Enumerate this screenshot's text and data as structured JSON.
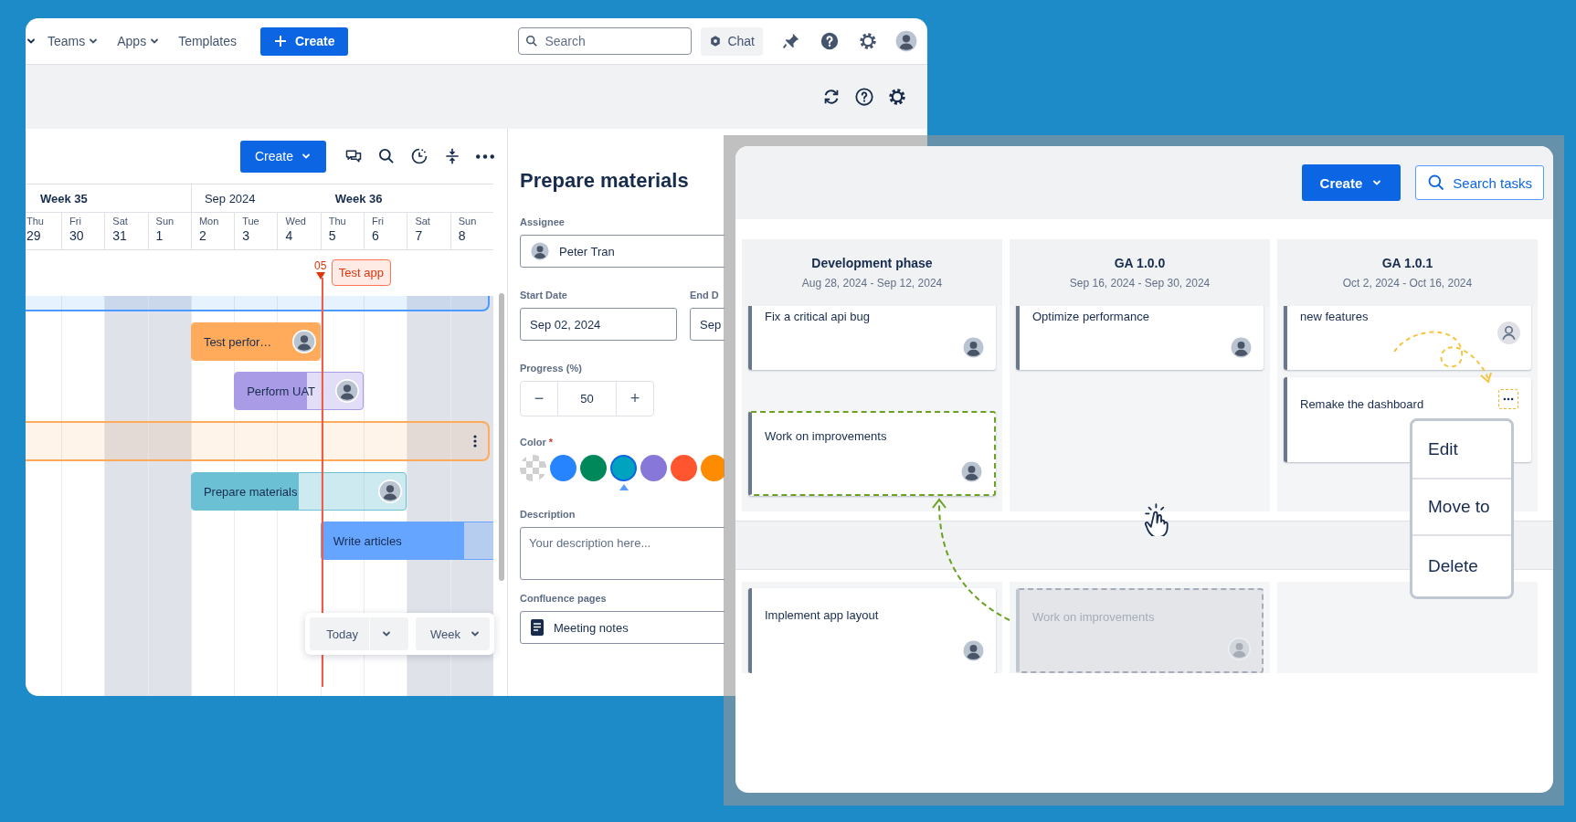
{
  "topbar": {
    "nav": [
      {
        "label": "Teams",
        "dropdown": true
      },
      {
        "label": "Apps",
        "dropdown": true
      },
      {
        "label": "Templates",
        "dropdown": false
      }
    ],
    "create_button": "Create",
    "search": {
      "placeholder": "Search"
    },
    "chat_button": "Chat"
  },
  "gantt": {
    "create_button": "Create",
    "weeks": [
      {
        "label": "Week 35",
        "kind": "week"
      },
      {
        "label": "Sep 2024",
        "kind": "month"
      },
      {
        "label": "Week 36",
        "kind": "week"
      }
    ],
    "days": [
      {
        "weekday": "Thu",
        "date": "29",
        "weekend": false
      },
      {
        "weekday": "Fri",
        "date": "30",
        "weekend": false
      },
      {
        "weekday": "Sat",
        "date": "31",
        "weekend": true
      },
      {
        "weekday": "Sun",
        "date": "1",
        "weekend": true
      },
      {
        "weekday": "Mon",
        "date": "2",
        "weekend": false
      },
      {
        "weekday": "Tue",
        "date": "3",
        "weekend": false
      },
      {
        "weekday": "Wed",
        "date": "4",
        "weekend": false
      },
      {
        "weekday": "Thu",
        "date": "5",
        "weekend": false
      },
      {
        "weekday": "Fri",
        "date": "6",
        "weekend": false
      },
      {
        "weekday": "Sat",
        "date": "7",
        "weekend": true
      },
      {
        "weekday": "Sun",
        "date": "8",
        "weekend": true
      }
    ],
    "milestone": {
      "day_label": "05",
      "title": "Test app"
    },
    "bars": [
      {
        "kind": "group",
        "color": "#4c9aff"
      },
      {
        "kind": "task",
        "title": "Test perfor…",
        "color": "#ffab5b",
        "level": 1,
        "avatar": true
      },
      {
        "kind": "task",
        "title": "Perform UAT",
        "color": "#a99be6",
        "level": 0.56,
        "avatar": true
      },
      {
        "kind": "group",
        "color": "#ffab5b"
      },
      {
        "kind": "task",
        "title": "Prepare materials",
        "color": "#6cc0d4",
        "level": 0.5,
        "avatar": true
      },
      {
        "kind": "task",
        "title": "Write articles",
        "color": "#65a4ff",
        "level": 0.83,
        "avatar": false
      }
    ],
    "zoom_controls": [
      {
        "label": "Today"
      },
      {
        "label": "Week"
      }
    ]
  },
  "panel": {
    "title": "Prepare materials",
    "assignee": {
      "label": "Assignee",
      "value": "Peter Tran"
    },
    "start_date": {
      "label": "Start Date",
      "value": "Sep 02, 2024"
    },
    "end_date": {
      "label": "End D",
      "value": "Sep"
    },
    "progress": {
      "label": "Progress (%)",
      "value": "50",
      "minus": "−",
      "plus": "+"
    },
    "color": {
      "label": "Color",
      "required_mark": "*",
      "swatches": [
        {
          "kind": "transparent",
          "selected": false
        },
        {
          "kind": "solid",
          "color": "#2684ff",
          "selected": false
        },
        {
          "kind": "solid",
          "color": "#00875a",
          "selected": false
        },
        {
          "kind": "solid",
          "color": "#00a3bf",
          "selected": true
        },
        {
          "kind": "solid",
          "color": "#8777d9",
          "selected": false
        },
        {
          "kind": "solid",
          "color": "#ff5630",
          "selected": false
        },
        {
          "kind": "solid",
          "color": "#ff8b00",
          "selected": false
        }
      ]
    },
    "description": {
      "label": "Description",
      "placeholder": "Your description here..."
    },
    "confluence": {
      "label": "Confluence pages",
      "value": "Meeting notes"
    }
  },
  "board": {
    "create_button": "Create",
    "search_button": "Search tasks",
    "columns": [
      {
        "name": "Development phase",
        "dates": "Aug 28, 2024 - Sep 12, 2024"
      },
      {
        "name": "GA 1.0.0",
        "dates": "Sep 16, 2024 - Sep 30, 2024"
      },
      {
        "name": "GA 1.0.1",
        "dates": "Oct 2, 2024 - Oct 16, 2024"
      }
    ],
    "lanes": [
      {
        "cells": [
          {
            "cards": [
              {
                "title": "Fix a critical api bug",
                "kind": "normal",
                "assigned": true,
                "menu_open": false
              },
              {
                "title": "Work on improvements",
                "kind": "drop_target",
                "assigned": true,
                "menu_open": false
              }
            ]
          },
          {
            "cards": [
              {
                "title": "Optimize performance",
                "kind": "normal",
                "assigned": true,
                "menu_open": false
              }
            ]
          },
          {
            "cards": [
              {
                "title": "new features",
                "kind": "normal",
                "assigned": false,
                "menu_open": false
              },
              {
                "title": "Remake the dashboard",
                "kind": "normal",
                "menu_open": true
              }
            ]
          }
        ]
      },
      {
        "cells": [
          {
            "cards": [
              {
                "title": "Implement app layout",
                "kind": "normal",
                "assigned": true,
                "menu_open": false
              }
            ]
          },
          {
            "cards": [
              {
                "title": "Work on improvements",
                "kind": "ghost",
                "assigned": true,
                "menu_open": false
              }
            ]
          },
          {}
        ]
      }
    ],
    "menu": {
      "items": [
        {
          "label": "Edit"
        },
        {
          "label": "Move to"
        },
        {
          "label": "Delete"
        }
      ]
    }
  }
}
